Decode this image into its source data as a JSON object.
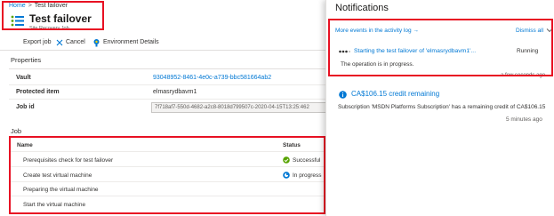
{
  "breadcrumb": {
    "home": "Home",
    "separator": ">",
    "current": "Test failover"
  },
  "header": {
    "title": "Test failover",
    "subtitle": "Site Recovery Job"
  },
  "toolbar": {
    "export_label": "Export job",
    "cancel_label": "Cancel",
    "environment_label": "Environment Details"
  },
  "properties": {
    "heading": "Properties",
    "vault_label": "Vault",
    "vault_value": "93048952-8461-4e0c-a739-bbc581664ab2",
    "protected_item_label": "Protected item",
    "protected_item_value": "elmasrydbavm1",
    "job_id_label": "Job id",
    "job_id_value": "7f718af7-550d-4682-a2c8-8018d799507c-2020-04-15T13:25:462"
  },
  "job": {
    "heading": "Job",
    "col_name": "Name",
    "col_status": "Status",
    "rows": [
      {
        "name": "Prerequisites check for test failover",
        "status": "Successful",
        "status_icon": "check-circle-icon"
      },
      {
        "name": "Create test virtual machine",
        "status": "In progress",
        "status_icon": "in-progress-icon"
      },
      {
        "name": "Preparing the virtual machine",
        "status": ""
      },
      {
        "name": "Start the virtual machine",
        "status": ""
      }
    ]
  },
  "notifications": {
    "title": "Notifications",
    "activity_link": "More events in the activity log →",
    "dismiss_label": "Dismiss all",
    "items": [
      {
        "title": "Starting the test failover of 'elmasrydbavm1'...",
        "status": "Running",
        "description": "The operation is in progress.",
        "time": "a few seconds ago"
      },
      {
        "title": "CA$106.15 credit remaining",
        "description": "Subscription 'MSDN Platforms Subscription' has a remaining credit of CA$106.15",
        "time": "5 minutes ago"
      }
    ]
  },
  "colors": {
    "accent": "#0078d4",
    "highlight": "#e81123",
    "success": "#57a300"
  }
}
